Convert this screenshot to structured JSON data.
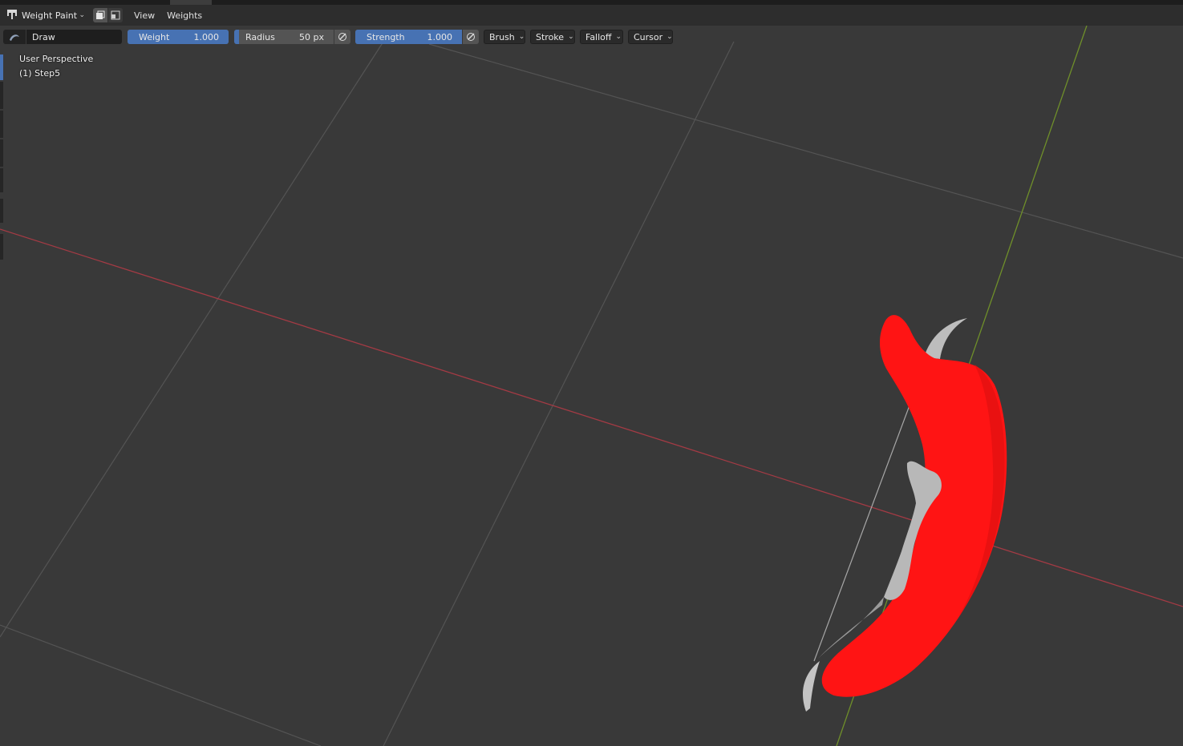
{
  "header": {
    "mode_label": "Weight Paint",
    "menus": [
      "View",
      "Weights"
    ]
  },
  "toolbar": {
    "brush_name": "Draw",
    "weight": {
      "label": "Weight",
      "value": "1.000"
    },
    "radius": {
      "label": "Radius",
      "value": "50 px"
    },
    "strength": {
      "label": "Strength",
      "value": "1.000"
    },
    "dropdowns": [
      "Brush",
      "Stroke",
      "Falloff",
      "Cursor"
    ]
  },
  "viewport": {
    "perspective_label": "User Perspective",
    "object_label": "(1) Step5"
  },
  "colors": {
    "background": "#393939",
    "grid": "#545454",
    "x_axis": "#a33a44",
    "y_axis": "#6f8f2a",
    "weight_color": "#ff1414",
    "bone": "#b8b8b8",
    "accent": "#4772b3"
  },
  "icons": [
    "weight-paint-mode-icon",
    "brush-thumbnail-icon",
    "pressure-icon",
    "chevron-down-icon"
  ]
}
